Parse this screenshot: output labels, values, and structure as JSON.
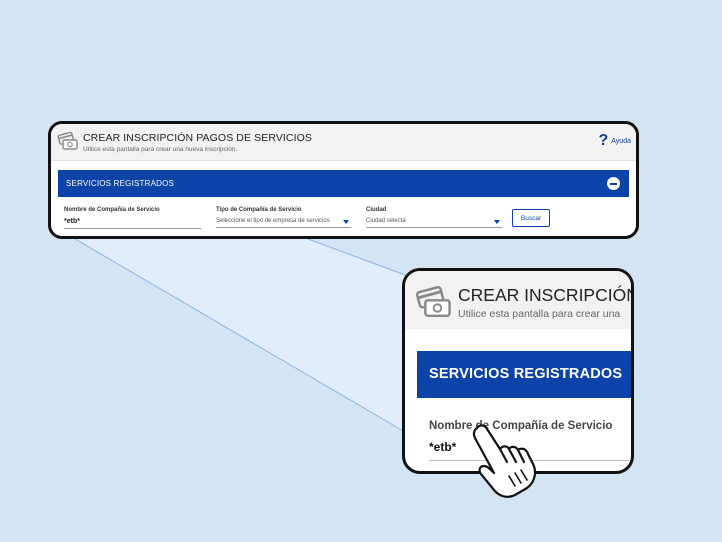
{
  "panel": {
    "title": "CREAR INSCRIPCIÓN PAGOS DE SERVICIOS",
    "subtitle": "Utilice esta pantalla para crear una nueva inscripción.",
    "help_label": "Ayuda",
    "help_glyph": "?",
    "section_title": "SERVICIOS REGISTRADOS",
    "fields": {
      "company_name": {
        "label": "Nombre de Compañía de Servicio",
        "value": "*etb*"
      },
      "company_type": {
        "label": "Tipo de Compañía de Servicio",
        "value": "Seleccione el tipo de empresa de servicios"
      },
      "city": {
        "label": "Ciudad",
        "value": "Ciudad selecta"
      }
    },
    "search_button": "Buscar"
  },
  "zoom": {
    "title": "CREAR INSCRIPCIÓN",
    "subtitle": "Utilice esta pantalla para crear una",
    "section_title": "SERVICIOS REGISTRADOS",
    "field_label": "Nombre de Compañía de Servicio",
    "field_value": "*etb*"
  },
  "icons": [
    "payment-cards-icon",
    "help-question-icon",
    "collapse-minus-icon",
    "dropdown-caret-icon",
    "pointing-hand-cursor-icon"
  ],
  "colors": {
    "background": "#d3e4f5",
    "primary_blue": "#0b43a8",
    "header_gray": "#f2f2f2",
    "help_blue": "#0b3d91"
  }
}
